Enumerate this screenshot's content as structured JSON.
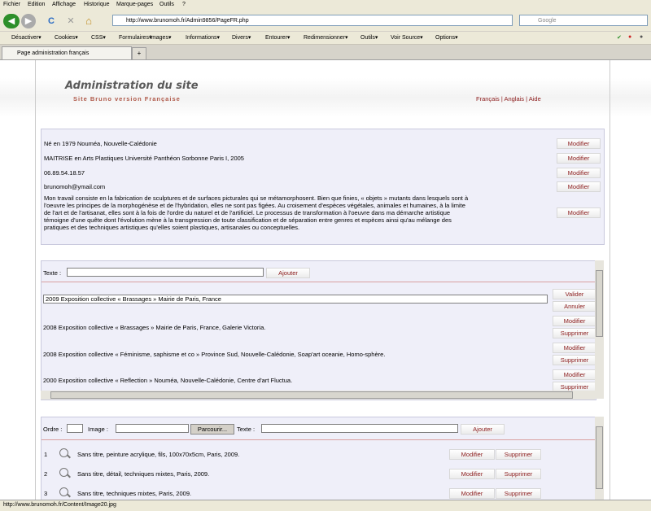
{
  "menu": [
    "Fichier",
    "Edition",
    "Affichage",
    "Historique",
    "Marque-pages",
    "Outils",
    "?"
  ],
  "nav": {
    "back": "◀",
    "forward": "▶",
    "reload": "C",
    "stop": "✕",
    "home": "⌂",
    "url": "http://www.brunomoh.fr/Admin9856/PageFR.php",
    "search_placeholder": "Google"
  },
  "toolbar": [
    "Désactiver▾",
    "Cookies▾",
    "CSS▾",
    "Formulaires▾",
    "Images▾",
    "Informations▾",
    "Divers▾",
    "Entourer▾",
    "Redimensionner▾",
    "Outils▾",
    "Voir Source▾",
    "Options▾"
  ],
  "tab": {
    "title": "Page administration français",
    "new": "+"
  },
  "header": {
    "title": "Administration du site",
    "subtitle": "Site Bruno version Française",
    "langs": "Français | Anglais | Aide"
  },
  "bio": [
    "Né en 1979 Nouméa, Nouvelle-Calédonie",
    "MAITRISE en Arts Plastiques Université Panthéon Sorbonne Paris I, 2005",
    "06.89.54.18.57",
    "brunomoh@ymail.com"
  ],
  "bio_long": [
    "Mon travail consiste en la fabrication de sculptures et de surfaces picturales qui se métamorphosent. Bien que finies, « objets » mutants dans lesquels sont à",
    "l'oeuvre les principes de la morphogénèse et de l'hybridation, elles ne sont pas figées. Au croisement d'espèces végétales, animales et humaines, à la limite",
    "de l'art et de l'artisanat, elles sont à la fois de l'ordre du naturel et de l'artificiel. Le processus de transformation à l'oeuvre dans ma démarche artistique",
    "témoigne d'une quête dont l'évolution mène à la transgression de toute classification et de séparation entre genres et espèces ainsi qu'au mélange des",
    "pratiques et des techniques artistiques qu'elles soient plastiques, artisanales ou conceptuelles."
  ],
  "labels": {
    "modifier": "Modifier",
    "supprimer": "Supprimer",
    "valider": "Valider",
    "annuler": "Annuler",
    "ajouter": "Ajouter",
    "texte": "Texte :",
    "ordre": "Ordre :",
    "image": "Image :",
    "parcourir": "Parcourir..."
  },
  "expo_edit_value": "2009 Exposition collective « Brassages » Mairie de Paris, France",
  "expos": [
    "2008 Exposition collective « Brassages » Mairie de Paris, France, Galerie Victoria.",
    "2008 Exposition collective « Féminisme, saphisme et co » Province Sud, Nouvelle-Calédonie, Soap'art oceanie, Homo-sphère.",
    "2000 Exposition collective « Reflection » Nouméa, Nouvelle-Calédonie, Centre d'art Fluctua."
  ],
  "images": [
    {
      "n": "1",
      "text": "Sans titre, peinture acrylique, fils, 100x70x5cm, Paris, 2009."
    },
    {
      "n": "2",
      "text": "Sans titre, détail, techniques mixtes, Paris, 2009."
    },
    {
      "n": "3",
      "text": "Sans titre, techniques mixtes, Paris, 2009."
    }
  ],
  "status": "http://www.brunomoh.fr/Content/Image20.jpg"
}
